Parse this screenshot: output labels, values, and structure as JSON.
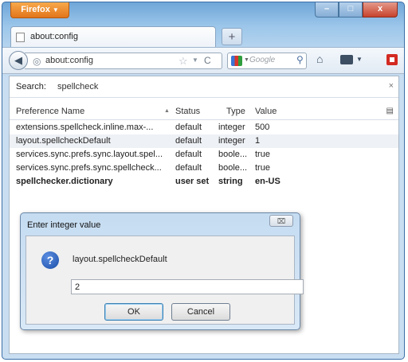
{
  "browser": {
    "app_button": "Firefox",
    "window_controls": {
      "minimize": "–",
      "maximize": "□",
      "close": "x"
    },
    "tab": {
      "label": "about:config"
    },
    "new_tab": "+",
    "url": "about:config",
    "search_placeholder": "Google"
  },
  "config": {
    "search_label": "Search:",
    "search_value": "spellcheck",
    "clear": "×",
    "columns": {
      "name": "Preference Name",
      "status": "Status",
      "type": "Type",
      "value": "Value"
    },
    "rows": [
      {
        "name": "extensions.spellcheck.inline.max-...",
        "status": "default",
        "type": "integer",
        "value": "500"
      },
      {
        "name": "layout.spellcheckDefault",
        "status": "default",
        "type": "integer",
        "value": "1"
      },
      {
        "name": "services.sync.prefs.sync.layout.spel...",
        "status": "default",
        "type": "boole...",
        "value": "true"
      },
      {
        "name": "services.sync.prefs.sync.spellcheck...",
        "status": "default",
        "type": "boole...",
        "value": "true"
      },
      {
        "name": "spellchecker.dictionary",
        "status": "user set",
        "type": "string",
        "value": "en-US"
      }
    ]
  },
  "dialog": {
    "title": "Enter integer value",
    "close": "⌧",
    "prompt": "layout.spellcheckDefault",
    "value": "2",
    "ok": "OK",
    "cancel": "Cancel"
  }
}
